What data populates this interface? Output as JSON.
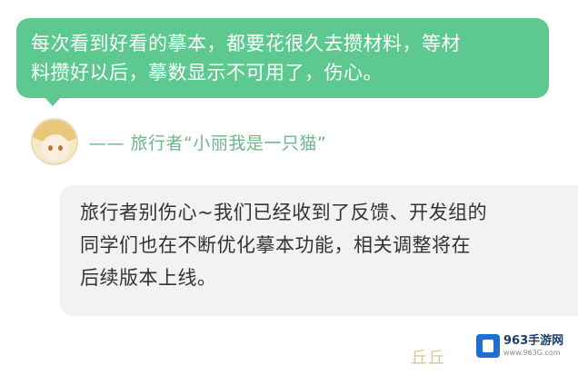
{
  "feedback": {
    "line1": "每次看到好看的摹本，都要花很久去攒材料，等材",
    "line2": "料攒好以后，摹数显示不可用了，伤心。"
  },
  "author": {
    "prefix": "—— 旅行者“小丽我是一只猫”",
    "avatar_icon": "anime-avatar-icon"
  },
  "reply": {
    "line1": "旅行者别伤心~我们已经收到了反馈、开发组的",
    "line2": "同学们也在不断优化摹本功能，相关调整将在",
    "line3": "后续版本上线。"
  },
  "footer": {
    "faint_mark": "丘丘"
  },
  "watermark": {
    "title": "963手游网",
    "url": "www.963G.com"
  },
  "colors": {
    "feedback_bubble": "#5ec98e",
    "author_text": "#6fb68b",
    "reply_bubble": "#f2f2f2",
    "reply_text": "#333333",
    "watermark_blue": "#1e6fd1"
  }
}
